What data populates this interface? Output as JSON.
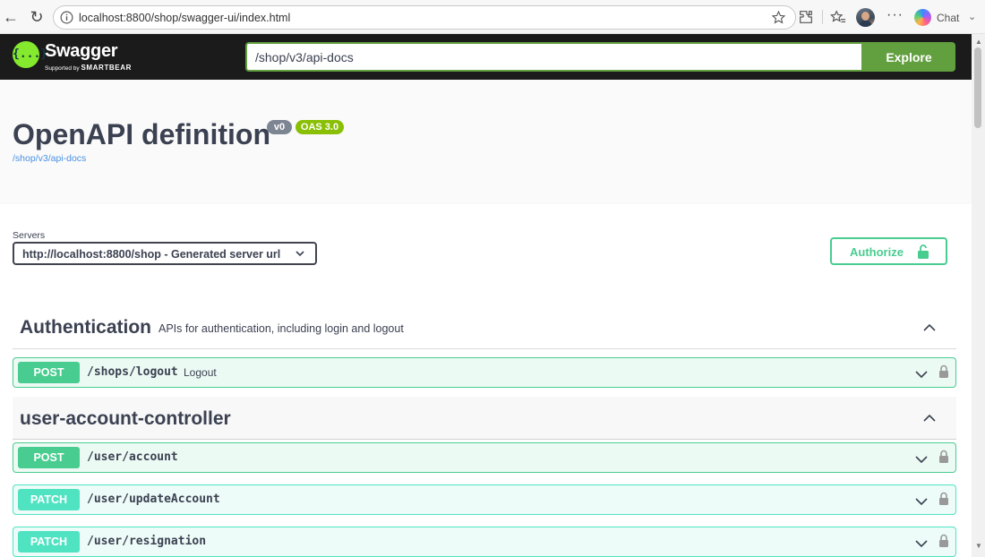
{
  "browser": {
    "url": "localhost:8800/shop/swagger-ui/index.html",
    "chat_label": "Chat",
    "more_label": "···"
  },
  "topbar": {
    "logo_glyph": "{...}",
    "logo_title": "Swagger",
    "logo_supported": "Supported by",
    "logo_brand": "SMARTBEAR",
    "spec_url_value": "/shop/v3/api-docs",
    "explore_label": "Explore"
  },
  "info": {
    "title": "OpenAPI definition",
    "version_badge": "v0",
    "oas_badge": "OAS 3.0",
    "spec_link": "/shop/v3/api-docs"
  },
  "servers": {
    "label": "Servers",
    "selected": "http://localhost:8800/shop - Generated server url",
    "authorize_label": "Authorize"
  },
  "tags": [
    {
      "name": "Authentication",
      "description": "APIs for authentication, including login and logout",
      "operations": [
        {
          "method": "POST",
          "path": "/shops/logout",
          "summary": "Logout"
        }
      ]
    },
    {
      "name": "user-account-controller",
      "description": "",
      "operations": [
        {
          "method": "POST",
          "path": "/user/account",
          "summary": ""
        },
        {
          "method": "PATCH",
          "path": "/user/updateAccount",
          "summary": ""
        },
        {
          "method": "PATCH",
          "path": "/user/resignation",
          "summary": ""
        }
      ]
    }
  ],
  "colors": {
    "post": "#49cc90",
    "patch": "#50e3c2",
    "topbar_bg": "#1b1b1b",
    "explore": "#62a03f",
    "logo_green": "#85ea2d",
    "oas_badge": "#89bf04",
    "text": "#3b4151",
    "link": "#4990e2"
  }
}
